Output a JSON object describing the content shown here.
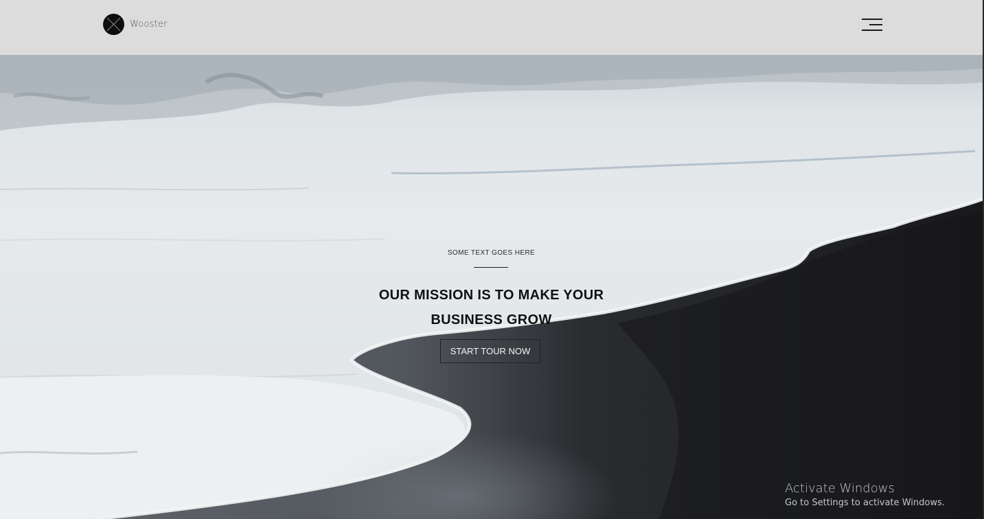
{
  "header": {
    "brand_name": "Wooster",
    "logo_icon": "x-circle-logo-icon",
    "menu_icon": "hamburger-menu-icon"
  },
  "hero": {
    "eyebrow": "SOME TEXT GOES HERE",
    "headline_line1": "OUR MISSION IS TO MAKE YOUR",
    "headline_line2": "BUSINESS GROW",
    "cta_label": "START TOUR NOW",
    "background": "ocean-waves-on-black-sand-beach"
  },
  "watermark": {
    "title": "Activate Windows",
    "subtitle": "Go to Settings to activate Windows."
  },
  "colors": {
    "header_bg": "#dcdcdc",
    "text_dark": "#111111",
    "sand_dark": "#1c1c1e",
    "foam": "#eef1f3"
  }
}
